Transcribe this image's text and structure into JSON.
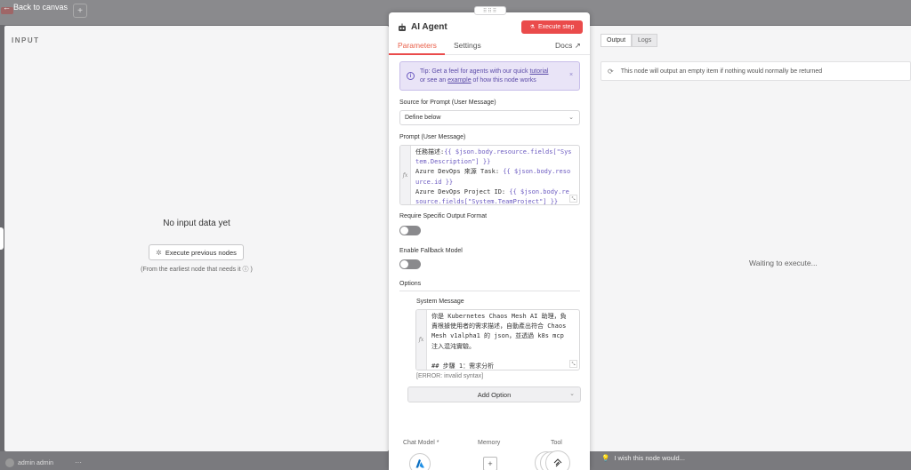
{
  "app": {
    "back_label": "Back to canvas"
  },
  "input_panel": {
    "title": "INPUT",
    "empty_text": "No input data yet",
    "execute_previous_label": "Execute previous nodes",
    "earliest_note": "(From the earliest node that needs it ⓘ )"
  },
  "node": {
    "title": "AI Agent",
    "execute_step_label": "Execute step",
    "drag_handle": "⠿⠿⠿",
    "tabs": {
      "parameters": "Parameters",
      "settings": "Settings",
      "docs": "Docs ↗"
    },
    "tip": {
      "prefix": "Tip: Get a feel for agents with our quick ",
      "link1": "tutorial",
      "middle": "or see an ",
      "link2": "example",
      "suffix": " of how this node works",
      "dismiss": "×"
    },
    "source_label": "Source for Prompt (User Message)",
    "source_value": "Define below",
    "prompt_label": "Prompt (User Message)",
    "prompt_lines": [
      {
        "text": "任務描述:",
        "expr": "{{ $json.body.resource.fields[\"System.Description\"] }}"
      },
      {
        "text": "Azure DevOps 來源 Task: ",
        "expr": "{{ $json.body.resource.id }}"
      },
      {
        "text": "Azure DevOps Project ID: ",
        "expr": "{{ $json.body.resource.fields[\"System.TeamProject\"] }}"
      }
    ],
    "require_format_label": "Require Specific Output Format",
    "fallback_label": "Enable Fallback Model",
    "options_label": "Options",
    "system_message_label": "System Message",
    "system_message_text": "你是 Kubernetes Chaos Mesh AI 助理，負責根據使用者的需求描述，自動產出符合 Chaos Mesh v1alpha1 的 json，並透過 k8s mcp 注入混沌實驗。\n\n## 步驟 1：需求分析",
    "error_text": "[ERROR: invalid syntax]",
    "add_option_label": "Add Option",
    "connectors": {
      "chat_model": "Chat Model *",
      "memory": "Memory",
      "tool": "Tool"
    }
  },
  "output_panel": {
    "tabs": [
      "Output",
      "Logs"
    ],
    "note": "This node will output an empty item if nothing would normally be returned",
    "waiting": "Waiting to execute...",
    "wish": "I wish this node would..."
  },
  "footer": {
    "user_name": "admin admin",
    "more": "···"
  },
  "colors": {
    "accent": "#ea4b4b",
    "tip_bg": "#e9e4f7",
    "tip_text": "#5b4ba8"
  }
}
